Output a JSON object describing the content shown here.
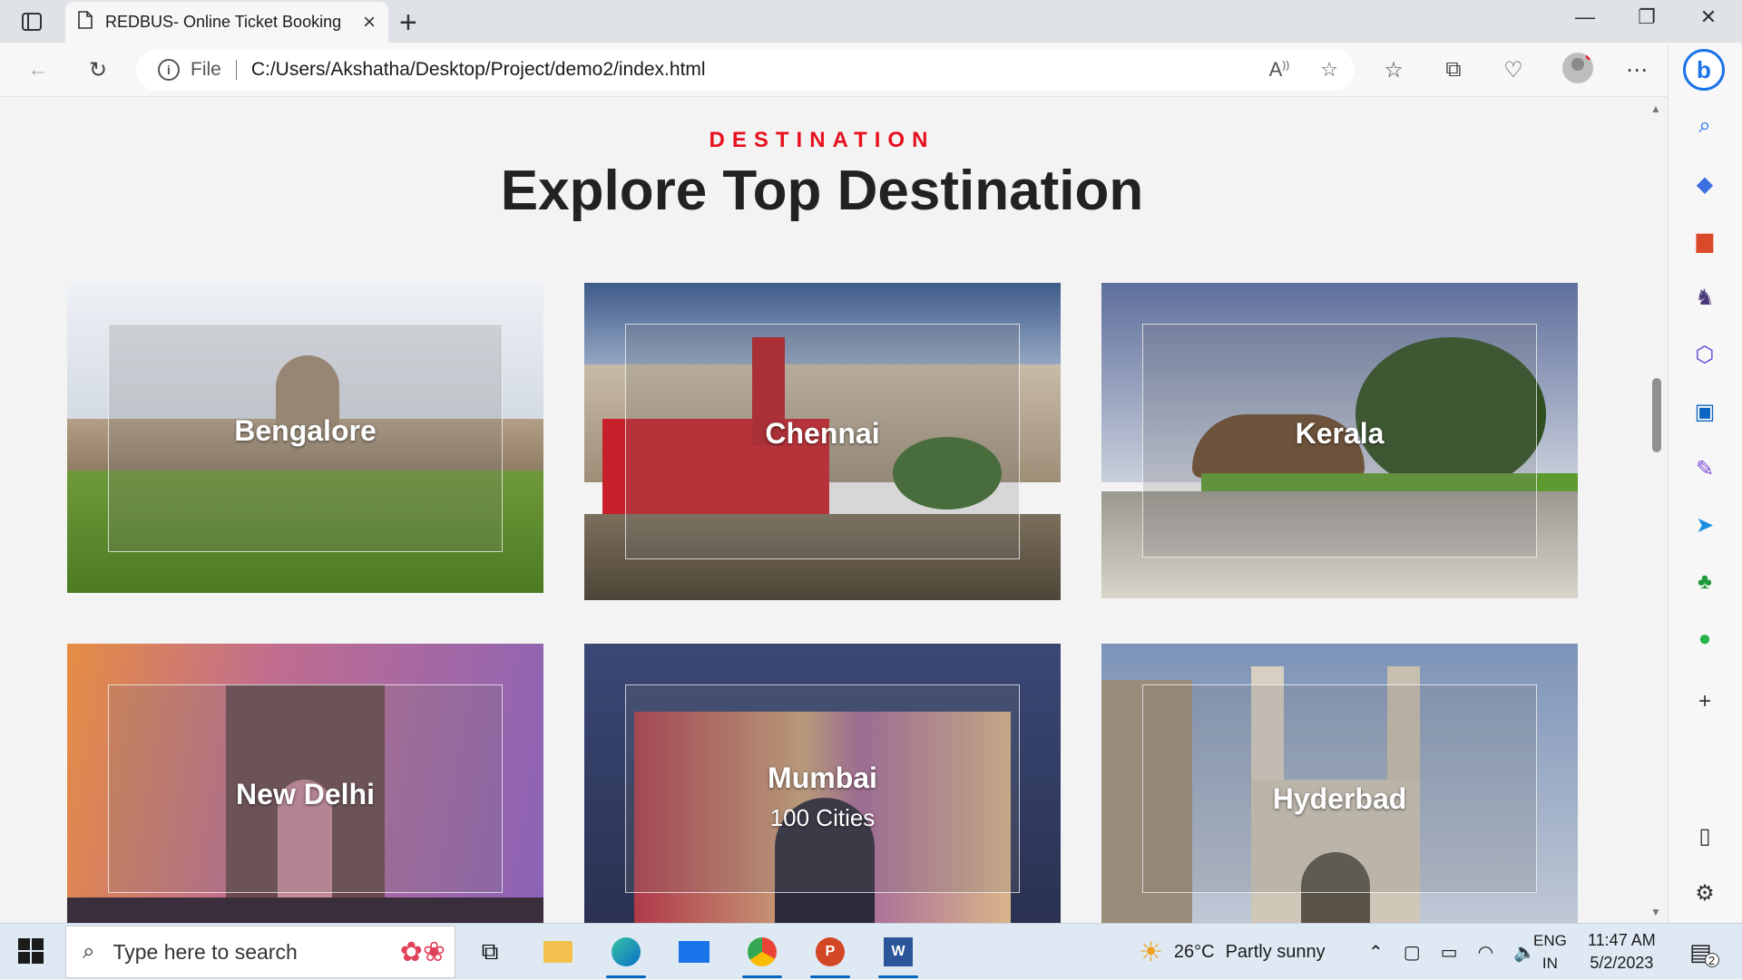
{
  "browser": {
    "tab_title": "REDBUS- Online Ticket Booking",
    "address_scheme": "File",
    "address_url": "C:/Users/Akshatha/Desktop/Project/demo2/index.html"
  },
  "page": {
    "subtitle": "DESTINATION",
    "heading": "Explore Top Destination",
    "cards": [
      {
        "name": "Bengalore",
        "sub": ""
      },
      {
        "name": "Chennai",
        "sub": ""
      },
      {
        "name": "Kerala",
        "sub": ""
      },
      {
        "name": "New Delhi",
        "sub": ""
      },
      {
        "name": "Mumbai",
        "sub": "100 Cities"
      },
      {
        "name": "Hyderbad",
        "sub": ""
      }
    ]
  },
  "taskbar": {
    "search_placeholder": "Type here to search",
    "weather_temp": "26°C",
    "weather_desc": "Partly sunny",
    "lang_line1": "ENG",
    "lang_line2": "IN",
    "time": "11:47 AM",
    "date": "5/2/2023",
    "notification_count": "2"
  },
  "icons": [
    "sidebar-icon",
    "file-icon",
    "close-icon",
    "plus-icon",
    "back-icon",
    "refresh-icon",
    "info-icon",
    "read-aloud-icon",
    "favorite-add-icon",
    "favorites-icon",
    "collections-icon",
    "health-icon",
    "profile-icon",
    "more-icon",
    "bing-icon",
    "search-icon",
    "tag-icon",
    "briefcase-icon",
    "chess-icon",
    "office-icon",
    "outlook-icon",
    "games-icon",
    "send-icon",
    "tree-icon",
    "whatsapp-icon",
    "windows-icon",
    "weather-icon"
  ]
}
